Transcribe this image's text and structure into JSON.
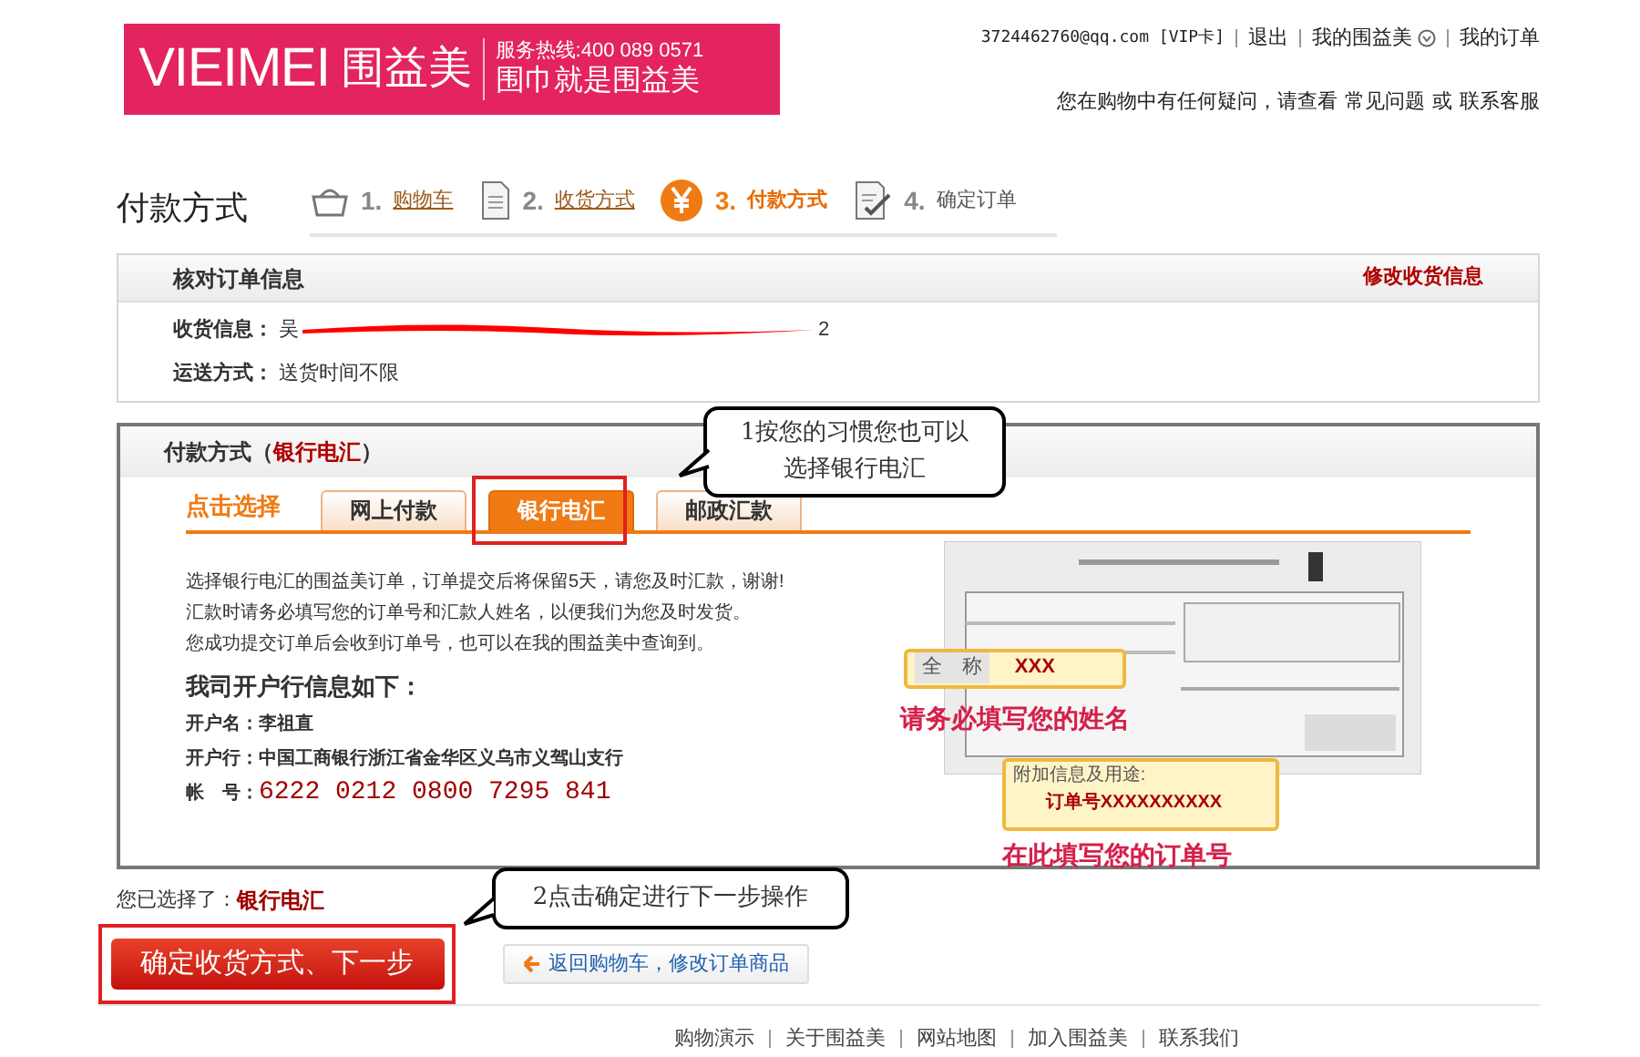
{
  "logo": {
    "brand_latin": "VIEIMEI",
    "brand_cn": "围益美",
    "hotline": "服务热线:400 089 0571",
    "slogan": "围巾就是围益美"
  },
  "top_links": [
    "3724462760@qq.com [VIP卡]",
    "退出",
    "我的围益美",
    "我的订单"
  ],
  "help": {
    "text": "您在购物中有任何疑问，请查看",
    "link1": "常见问题",
    "or": "或",
    "link2": "联系客服"
  },
  "page_title": "付款方式",
  "steps": [
    {
      "number": "1.",
      "label": "购物车",
      "completed": true,
      "selected": false,
      "kind": "basket"
    },
    {
      "number": "2.",
      "label": "收货方式",
      "completed": true,
      "selected": false,
      "kind": "document"
    },
    {
      "number": "3.",
      "label": "付款方式",
      "completed": false,
      "selected": true,
      "kind": "yen"
    },
    {
      "number": "4.",
      "label": "确定订单",
      "completed": false,
      "selected": false,
      "kind": "checklist"
    }
  ],
  "order_check": {
    "title": "核对订单信息",
    "edit_link": "修改收货信息",
    "rows": [
      {
        "label": "收货信息：",
        "value_start": "吴",
        "value_end": "2",
        "redacted": true
      },
      {
        "label": "运送方式：",
        "value_start": "送货时间不限",
        "value_end": ""
      }
    ]
  },
  "payment": {
    "title": "付款方式（",
    "method": "银行电汇",
    "title_end": "）",
    "tabs_caption": "点击选择",
    "tabs": [
      {
        "label": "网上付款",
        "selected": false
      },
      {
        "label": "银行电汇",
        "selected": true
      },
      {
        "label": "邮政汇款",
        "selected": false
      }
    ],
    "notes": [
      "选择银行电汇的围益美订单，订单提交后将保留5天，请您及时汇款，谢谢!",
      "汇款时请务必填写您的订单号和汇款人姓名，以便我们为您及时发货。",
      "您成功提交订单后会收到订单号，也可以在我的围益美中查询到。"
    ],
    "account_heading": "我司开户行信息如下：",
    "account": [
      {
        "label": "开户名：",
        "value": "李祖直",
        "kind": "plain"
      },
      {
        "label": "开户行：",
        "value": "中国工商银行浙江省金华区义乌市义驾山支行",
        "kind": "plain"
      },
      {
        "label": "帐　号：",
        "value": "6222 0212 0800 7295 841",
        "kind": "number"
      }
    ],
    "slip": {
      "kind": "picture",
      "name_field": "全　称",
      "name_value": "XXX",
      "name_hint": "请务必填写您的姓名",
      "purpose_label": "附加信息及用途:",
      "purpose_value": "订单号XXXXXXXXXX",
      "purpose_hint": "在此填写您的订单号"
    }
  },
  "selected_line": {
    "label": "您已选择了：",
    "value": "银行电汇"
  },
  "confirm_button": "确定收货方式、下一步",
  "back_button": "返回购物车，修改订单商品",
  "callouts": [
    [
      "1按您的习惯您也可以",
      "选择银行电汇"
    ],
    [
      "2点击确定进行下一步操作"
    ]
  ],
  "footer_links": [
    "购物演示",
    "关于围益美",
    "网站地图",
    "加入围益美",
    "联系我们"
  ]
}
